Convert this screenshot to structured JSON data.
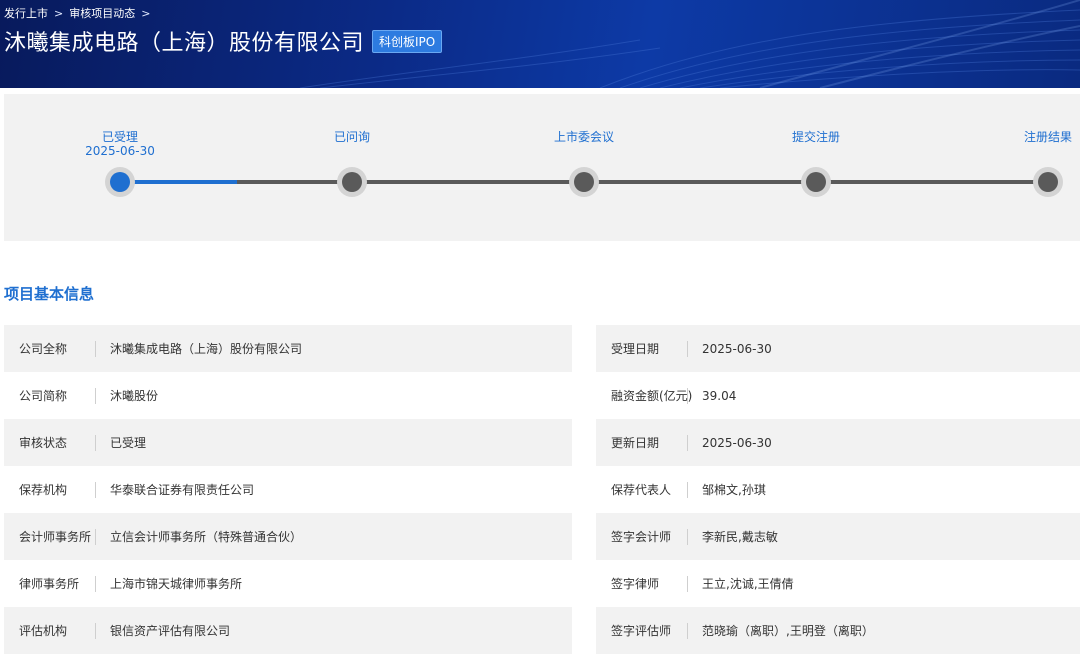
{
  "breadcrumb": {
    "items": [
      "发行上市",
      "审核项目动态"
    ]
  },
  "header": {
    "title": "沐曦集成电路（上海）股份有限公司",
    "tag": "科创板IPO"
  },
  "progress": {
    "steps": [
      {
        "label": "已受理",
        "date": "2025-06-30",
        "active": true
      },
      {
        "label": "已问询",
        "date": "",
        "active": false
      },
      {
        "label": "上市委会议",
        "date": "",
        "active": false
      },
      {
        "label": "提交注册",
        "date": "",
        "active": false
      },
      {
        "label": "注册结果",
        "date": "",
        "active": false
      }
    ],
    "completed_fraction": 0.125
  },
  "section_title": "项目基本信息",
  "info_left": [
    {
      "key": "公司全称",
      "value": "沐曦集成电路（上海）股份有限公司"
    },
    {
      "key": "公司简称",
      "value": "沐曦股份"
    },
    {
      "key": "审核状态",
      "value": "已受理"
    },
    {
      "key": "保荐机构",
      "value": "华泰联合证券有限责任公司"
    },
    {
      "key": "会计师事务所",
      "value": "立信会计师事务所（特殊普通合伙）"
    },
    {
      "key": "律师事务所",
      "value": "上海市锦天城律师事务所"
    },
    {
      "key": "评估机构",
      "value": "银信资产评估有限公司"
    }
  ],
  "info_right": [
    {
      "key": "受理日期",
      "value": "2025-06-30"
    },
    {
      "key": "融资金额(亿元)",
      "value": "39.04"
    },
    {
      "key": "更新日期",
      "value": "2025-06-30"
    },
    {
      "key": "保荐代表人",
      "value": "邹棉文,孙琪"
    },
    {
      "key": "签字会计师",
      "value": "李新民,戴志敏"
    },
    {
      "key": "签字律师",
      "value": "王立,沈诚,王倩倩"
    },
    {
      "key": "签字评估师",
      "value": "范晓瑜（离职）,王明登（离职）"
    }
  ],
  "colors": {
    "accent": "#1f6fd0",
    "banner": "#0b2a86",
    "row_shade": "#f2f2f2"
  }
}
